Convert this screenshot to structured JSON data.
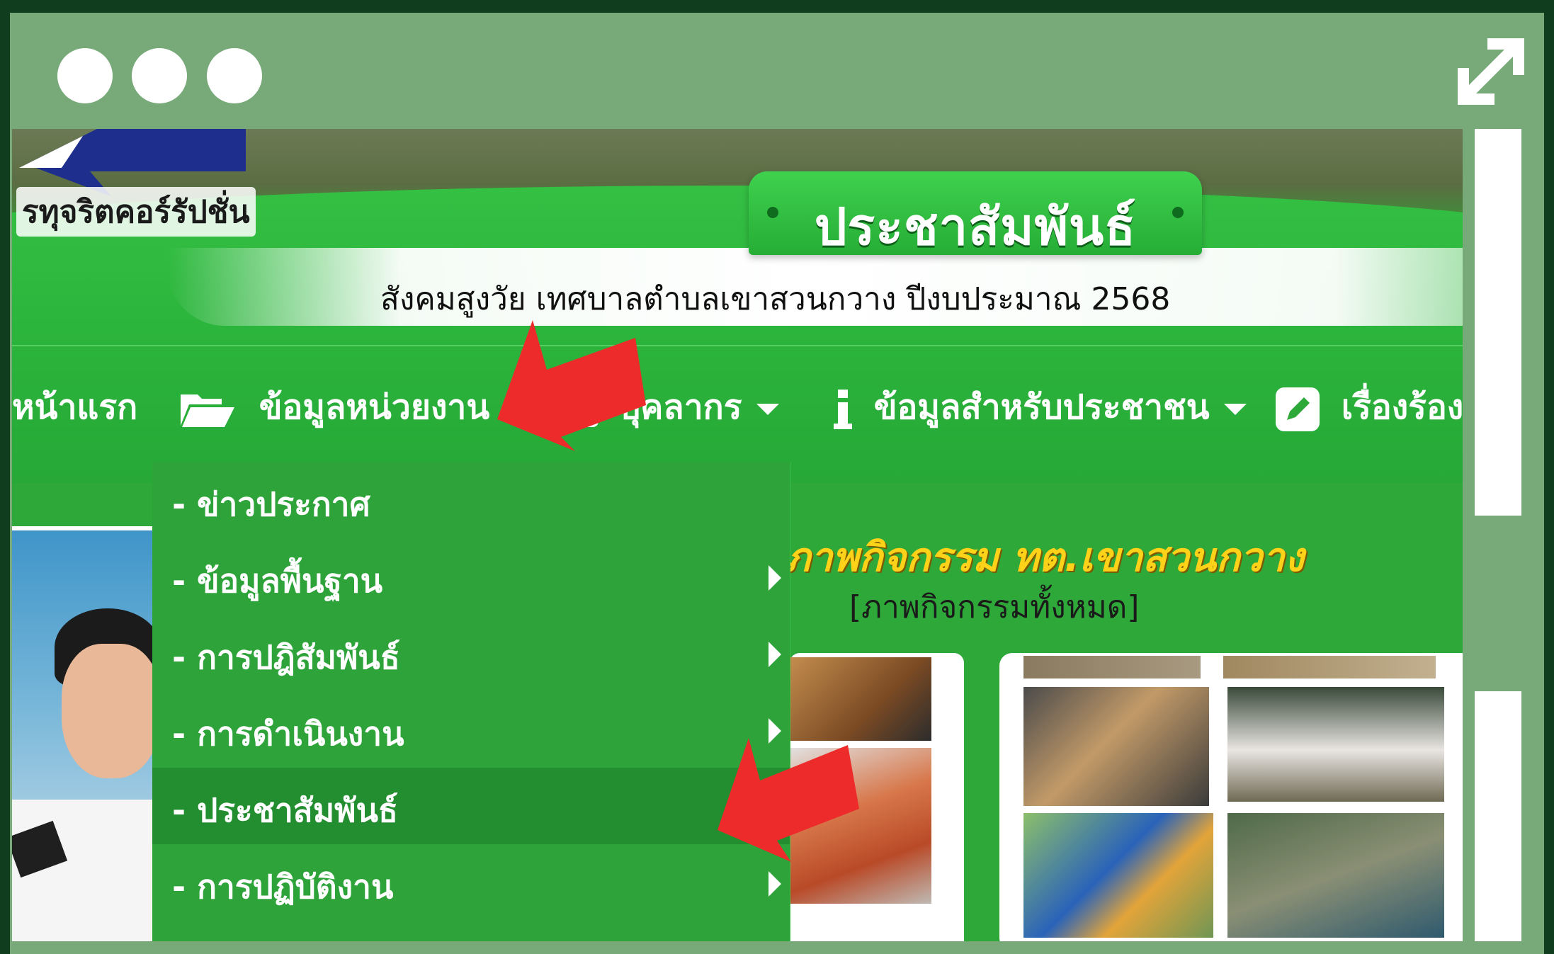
{
  "window": {
    "controls": [
      "dot",
      "dot",
      "dot"
    ],
    "expand_icon": "expand-arrows-icon"
  },
  "header": {
    "anti_corruption_label": "รทุจริตคอร์รัปชั่น",
    "title": "ประชาสัมพันธ์",
    "subtitle": "สังคมสูงวัย เทศบาลตำบลเขาสวนกวาง ปีงบประมาณ 2568"
  },
  "nav": {
    "items": [
      {
        "label": "หน้าแรก",
        "icon": null,
        "dropdown": false
      },
      {
        "label": "ข้อมูลหน่วยงาน",
        "icon": "folder-open-icon",
        "dropdown": false
      },
      {
        "label": "บุคลากร",
        "icon": "user-icon",
        "dropdown": true
      },
      {
        "label": "ข้อมูลสำหรับประชาชน",
        "icon": "info-icon",
        "dropdown": true
      },
      {
        "label": "เรื่องร้องเรี",
        "icon": "edit-icon",
        "dropdown": false
      }
    ]
  },
  "dropdown": {
    "items": [
      {
        "label": "- ข่าวประกาศ",
        "has_submenu": false,
        "active": false
      },
      {
        "label": "- ข้อมูลพื้นฐาน",
        "has_submenu": true,
        "active": false
      },
      {
        "label": "- การปฎิสัมพันธ์",
        "has_submenu": true,
        "active": false
      },
      {
        "label": "- การดำเนินงาน",
        "has_submenu": true,
        "active": false
      },
      {
        "label": "- ประชาสัมพันธ์",
        "has_submenu": false,
        "active": true
      },
      {
        "label": "- การปฏิบัติงาน",
        "has_submenu": true,
        "active": false
      }
    ]
  },
  "activity": {
    "title": "ภาพกิจกรรม ทต.เขาสวนกวาง",
    "all_link": "[ภาพกิจกรรมทั้งหมด]"
  },
  "colors": {
    "page_green": "#2fa83a",
    "frame": "#77a979",
    "outer": "#0f3d1d",
    "accent_yellow": "#ffd21a",
    "arrow_red": "#ee2b2b"
  }
}
